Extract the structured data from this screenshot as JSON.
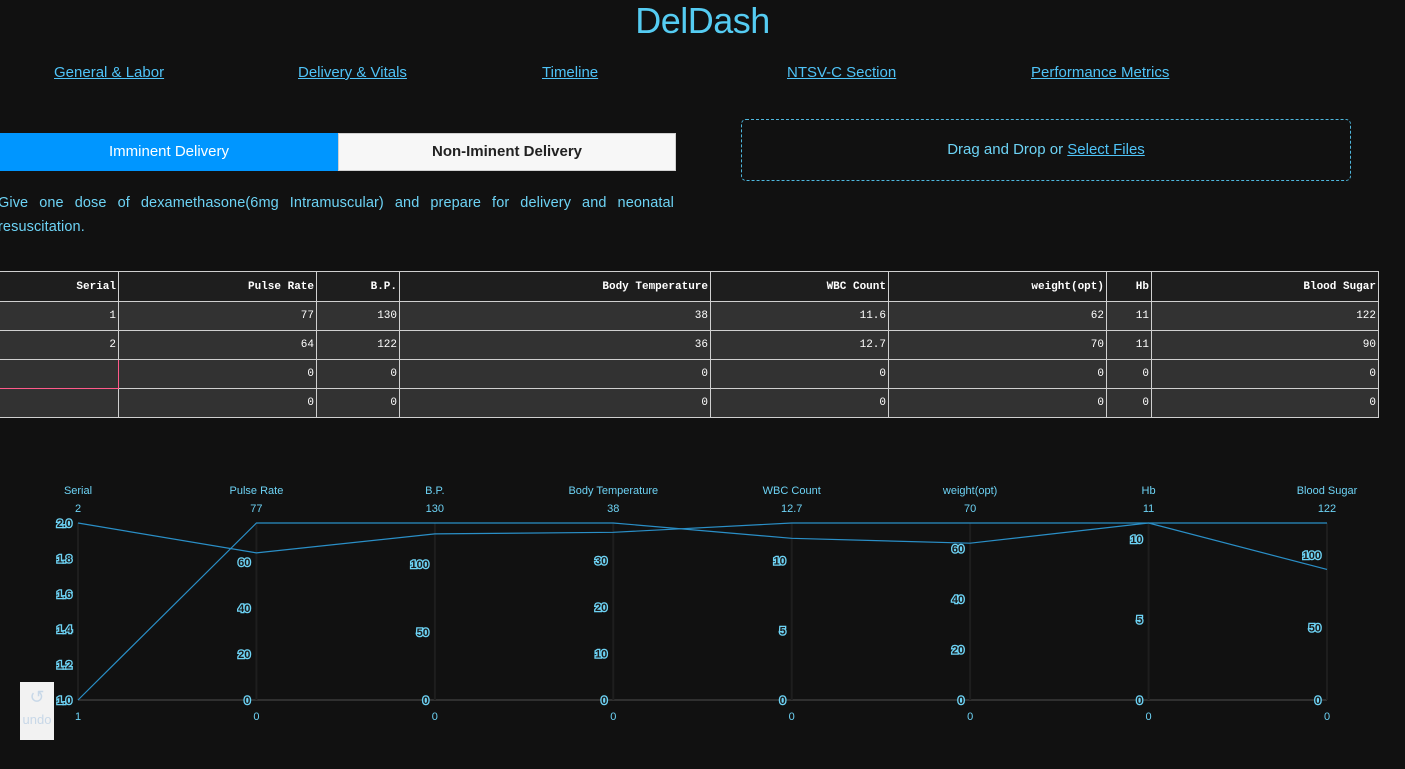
{
  "app": {
    "title": "DelDash"
  },
  "nav": [
    {
      "label": "General & Labor"
    },
    {
      "label": "Delivery & Vitals"
    },
    {
      "label": "Timeline"
    },
    {
      "label": "NTSV-C Section"
    },
    {
      "label": "Performance Metrics"
    }
  ],
  "tabs": {
    "active": "Imminent Delivery",
    "inactive": "Non-Iminent Delivery"
  },
  "upload": {
    "prefix": "Drag and Drop or ",
    "link": "Select Files"
  },
  "advice": "Give one dose of dexamethasone(6mg Intramuscular) and prepare for delivery and neonatal resuscitation.",
  "table": {
    "columns": [
      "Serial",
      "Pulse Rate",
      "B.P.",
      "Body Temperature",
      "WBC Count",
      "weight(opt)",
      "Hb",
      "Blood Sugar"
    ],
    "rows": [
      [
        "1",
        "77",
        "130",
        "38",
        "11.6",
        "62",
        "11",
        "122"
      ],
      [
        "2",
        "64",
        "122",
        "36",
        "12.7",
        "70",
        "11",
        "90"
      ],
      [
        "",
        "0",
        "0",
        "0",
        "0",
        "0",
        "0",
        "0"
      ],
      [
        "",
        "0",
        "0",
        "0",
        "0",
        "0",
        "0",
        "0"
      ]
    ]
  },
  "chart_data": {
    "type": "parallel_coordinates",
    "dimensions": [
      {
        "label": "Serial",
        "range": [
          1,
          2
        ],
        "top": "2",
        "bottom": "1",
        "ticks": [
          "1.0",
          "1.2",
          "1.4",
          "1.6",
          "1.8",
          "2.0"
        ]
      },
      {
        "label": "Pulse Rate",
        "range": [
          0,
          77
        ],
        "top": "77",
        "bottom": "0",
        "ticks": [
          "0",
          "20",
          "40",
          "60"
        ]
      },
      {
        "label": "B.P.",
        "range": [
          0,
          130
        ],
        "top": "130",
        "bottom": "0",
        "ticks": [
          "0",
          "50",
          "100"
        ]
      },
      {
        "label": "Body Temperature",
        "range": [
          0,
          38
        ],
        "top": "38",
        "bottom": "0",
        "ticks": [
          "0",
          "10",
          "20",
          "30"
        ]
      },
      {
        "label": "WBC Count",
        "range": [
          0,
          12.7
        ],
        "top": "12.7",
        "bottom": "0",
        "ticks": [
          "0",
          "5",
          "10"
        ]
      },
      {
        "label": "weight(opt)",
        "range": [
          0,
          70
        ],
        "top": "70",
        "bottom": "0",
        "ticks": [
          "0",
          "20",
          "40",
          "60"
        ]
      },
      {
        "label": "Hb",
        "range": [
          0,
          11
        ],
        "top": "11",
        "bottom": "0",
        "ticks": [
          "0",
          "5",
          "10"
        ]
      },
      {
        "label": "Blood Sugar",
        "range": [
          0,
          122
        ],
        "top": "122",
        "bottom": "0",
        "ticks": [
          "0",
          "50",
          "100"
        ]
      }
    ],
    "lines": [
      {
        "values": [
          1,
          77,
          130,
          38,
          11.6,
          62,
          11,
          122
        ]
      },
      {
        "values": [
          2,
          64,
          122,
          36,
          12.7,
          70,
          11,
          90
        ]
      }
    ],
    "line_color": "#2a8fc7"
  },
  "undo": {
    "label": "undo"
  },
  "colors": {
    "accent": "#0096ff",
    "text": "#6dd3f5",
    "background": "#111111"
  }
}
